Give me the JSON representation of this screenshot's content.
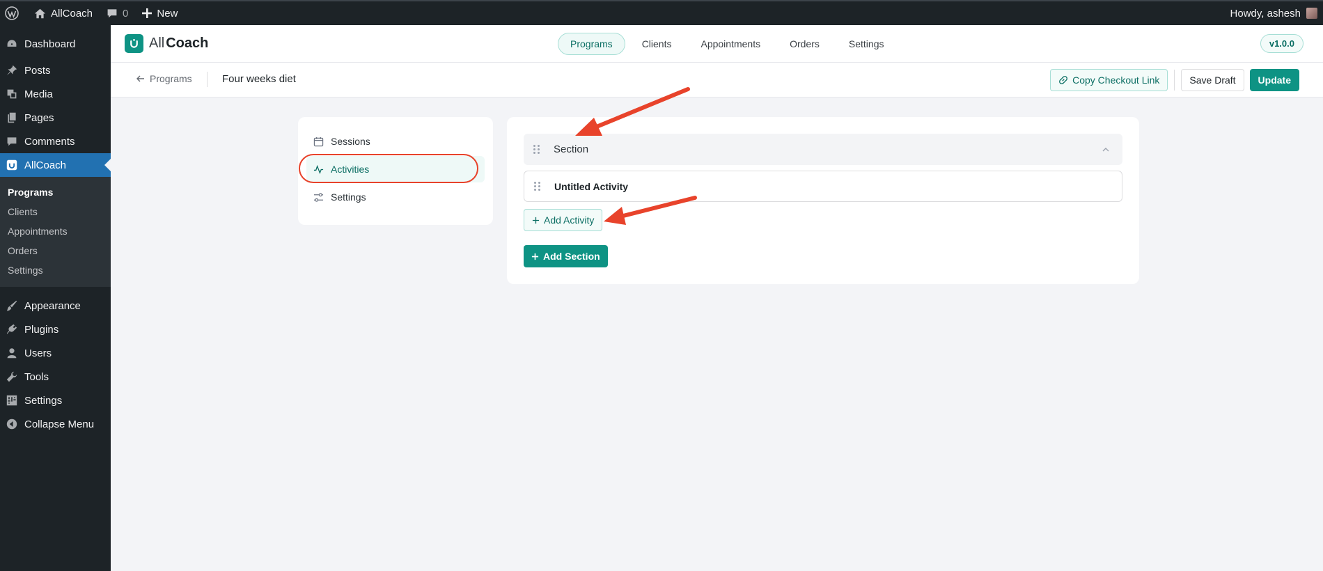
{
  "adminbar": {
    "site_name": "AllCoach",
    "comments_count": "0",
    "new_label": "New",
    "howdy": "Howdy, ashesh"
  },
  "wp_menu": {
    "dashboard": "Dashboard",
    "posts": "Posts",
    "media": "Media",
    "pages": "Pages",
    "comments": "Comments",
    "allcoach": "AllCoach",
    "submenu": [
      "Programs",
      "Clients",
      "Appointments",
      "Orders",
      "Settings"
    ],
    "appearance": "Appearance",
    "plugins": "Plugins",
    "users": "Users",
    "tools": "Tools",
    "settings": "Settings",
    "collapse": "Collapse Menu"
  },
  "app": {
    "logo_all": "All",
    "logo_coach": "Coach",
    "nav": [
      "Programs",
      "Clients",
      "Appointments",
      "Orders",
      "Settings"
    ],
    "version": "v1.0.0"
  },
  "subbar": {
    "back_label": "Programs",
    "title": "Four weeks diet",
    "copy_link": "Copy Checkout Link",
    "save_draft": "Save Draft",
    "update": "Update"
  },
  "left_menu": [
    "Sessions",
    "Activities",
    "Settings"
  ],
  "builder": {
    "section_title": "Section",
    "activity_title": "Untitled Activity",
    "add_activity": "Add Activity",
    "add_section": "Add Section"
  },
  "colors": {
    "accent": "#0e9384",
    "wp_active": "#2271b1",
    "annotation": "#e8432b"
  }
}
